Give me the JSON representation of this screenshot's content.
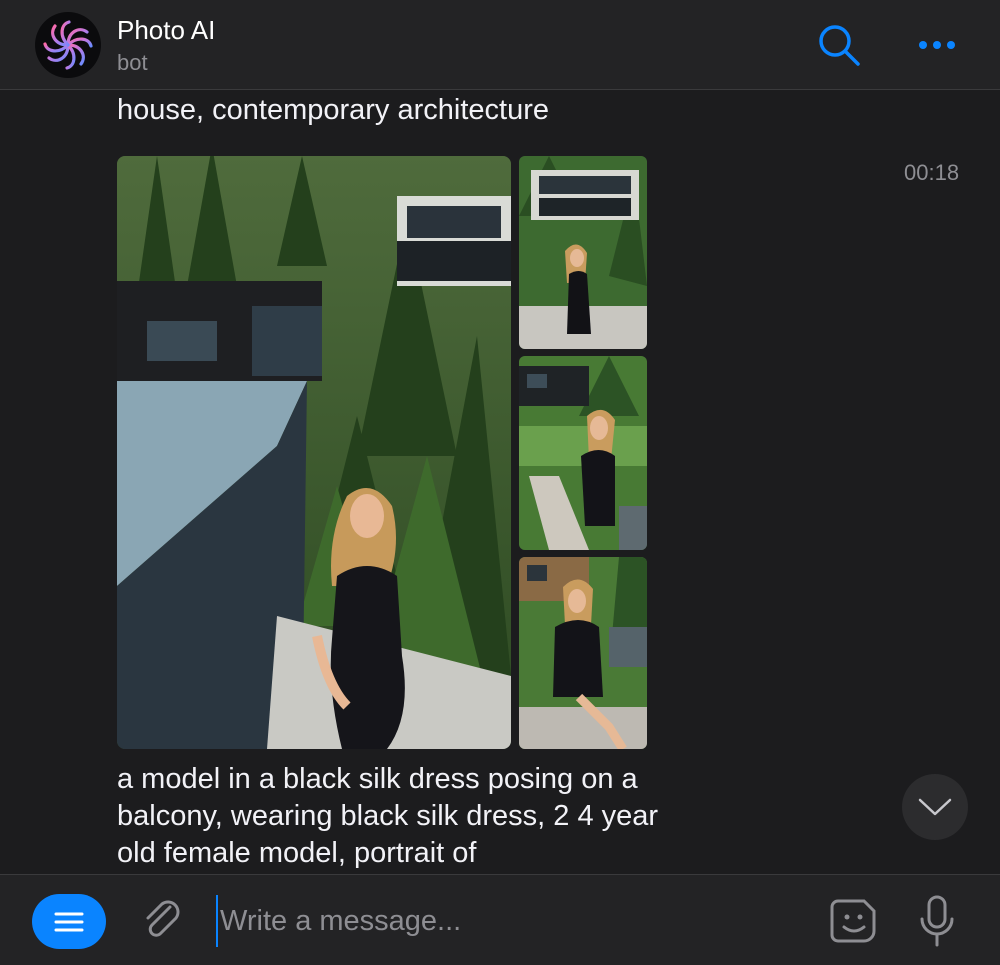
{
  "header": {
    "title": "Photo AI",
    "subtitle": "bot",
    "avatar_icon": "photo-ai-swirl-logo",
    "search_icon": "search-icon",
    "more_icon": "more-icon"
  },
  "chat": {
    "message_top": "house, contemporary architecture",
    "timestamp": "00:18",
    "message_bottom": "a model in a black silk dress posing on a balcony, wearing black silk dress, 2 4 year old female model, portrait of",
    "photos": [
      {
        "name": "main-photo",
        "subject": "model in black dress on balcony, modern house among pine trees"
      },
      {
        "name": "thumb-photo-1",
        "subject": "model standing on balcony with house behind"
      },
      {
        "name": "thumb-photo-2",
        "subject": "model in black dress leaning on railing"
      },
      {
        "name": "thumb-photo-3",
        "subject": "model seated on balcony ledge"
      }
    ]
  },
  "composer": {
    "placeholder": "Write a message...",
    "value": ""
  },
  "colors": {
    "accent": "#0a84ff",
    "background": "#1c1c1e",
    "bar": "#232325",
    "secondary_text": "#8e8e93"
  }
}
